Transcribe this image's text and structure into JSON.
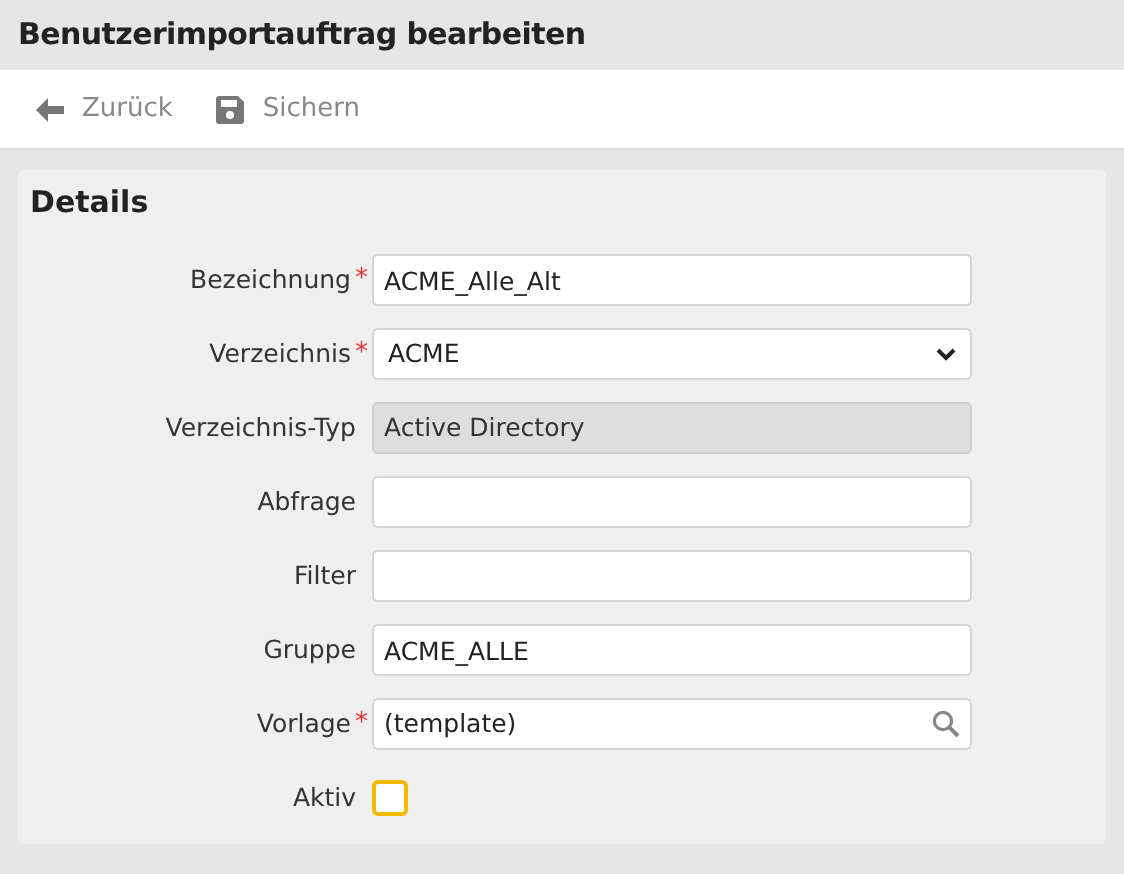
{
  "page_title": "Benutzerimportauftrag bearbeiten",
  "toolbar": [
    {
      "kind": "back",
      "label": "Zurück"
    },
    {
      "kind": "save",
      "label": "Sichern"
    }
  ],
  "panel": {
    "title": "Details",
    "fields": [
      {
        "kind": "text",
        "label": "Bezeichnung",
        "required_mark": "*",
        "value": "ACME_Alle_Alt"
      },
      {
        "kind": "select",
        "label": "Verzeichnis",
        "required_mark": "*",
        "value": "ACME"
      },
      {
        "kind": "readonly",
        "label": "Verzeichnis-Typ",
        "value": "Active Directory"
      },
      {
        "kind": "text",
        "label": "Abfrage"
      },
      {
        "kind": "text",
        "label": "Filter"
      },
      {
        "kind": "text",
        "label": "Gruppe",
        "value": "ACME_ALLE"
      },
      {
        "kind": "search",
        "label": "Vorlage",
        "required_mark": "*",
        "value": "(template)"
      },
      {
        "kind": "checkbox",
        "label": "Aktiv",
        "checked": false
      }
    ]
  }
}
